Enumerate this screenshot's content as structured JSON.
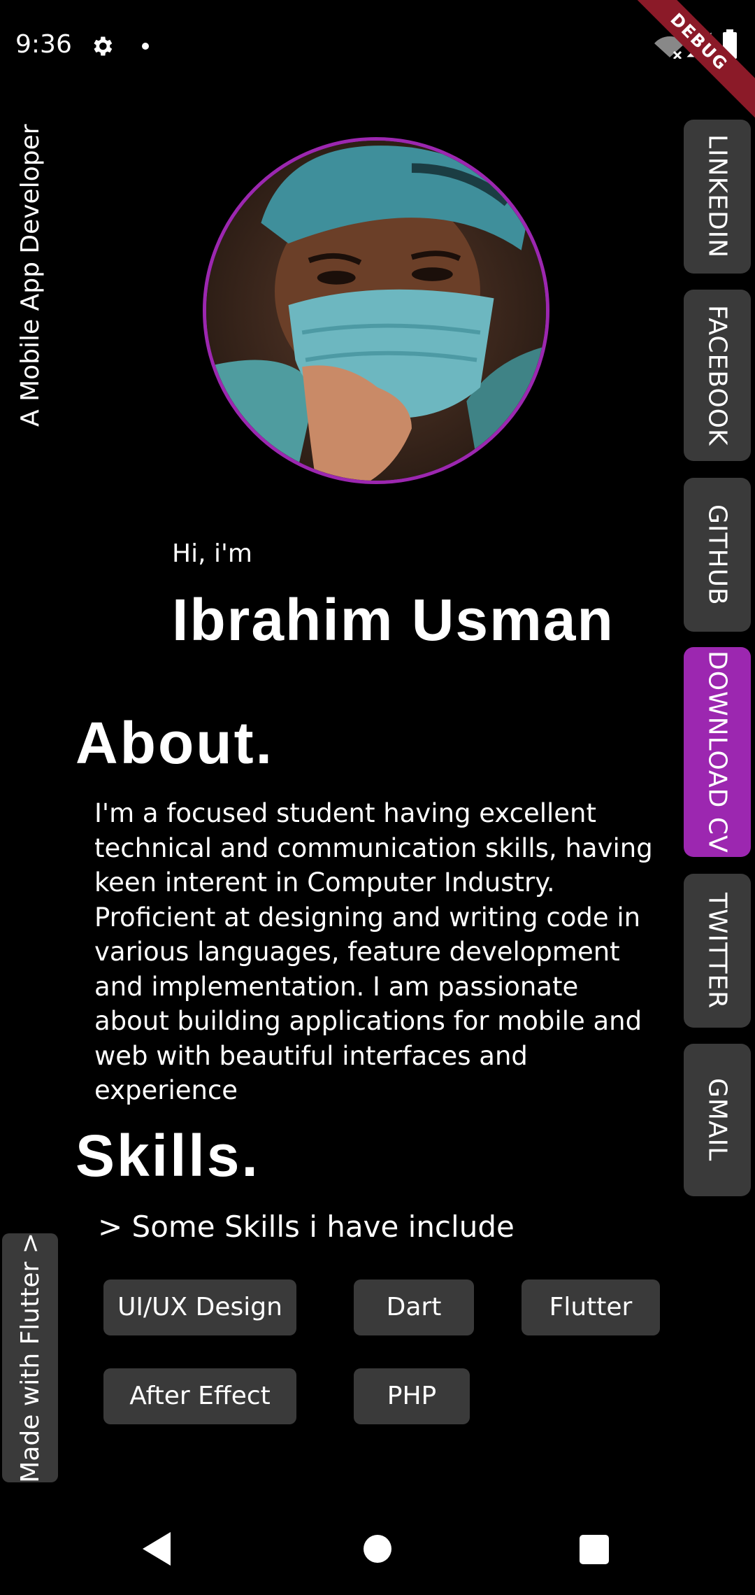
{
  "status_bar": {
    "time": "9:36",
    "icons": [
      "gear-icon",
      "notification-dot-icon",
      "wifi-off-icon",
      "signal-icon",
      "battery-icon"
    ],
    "debug_banner": "DEBUG"
  },
  "tagline": "A Mobile App Developer",
  "profile": {
    "greeting": "Hi, i'm",
    "name": "Ibrahim Usman",
    "ring_color": "#9c27b0"
  },
  "about": {
    "heading": "About.",
    "text": "I'm a focused student having excellent technical and communication skills, having keen interent in Computer Industry. Proficient at designing and writing code in various languages, feature development and implementation. I am passionate about building applications for mobile and web with beautiful interfaces and experience"
  },
  "skills": {
    "heading": "Skills.",
    "intro": "> Some Skills i have include",
    "items": [
      "UI/UX Design",
      "Dart",
      "Flutter",
      "After Effect",
      "PHP"
    ]
  },
  "side_nav": {
    "items": [
      "LINKEDIN",
      "FACEBOOK",
      "GITHUB",
      "DOWNLOAD CV",
      "TWITTER",
      "GMAIL"
    ],
    "active": "DOWNLOAD CV",
    "active_color": "#9c27b0",
    "inactive_color": "#3a3a3a"
  },
  "flutter_badge": "Made with Flutter >",
  "nav_bar": {
    "icons": [
      "back-icon",
      "home-icon",
      "recents-icon"
    ]
  }
}
